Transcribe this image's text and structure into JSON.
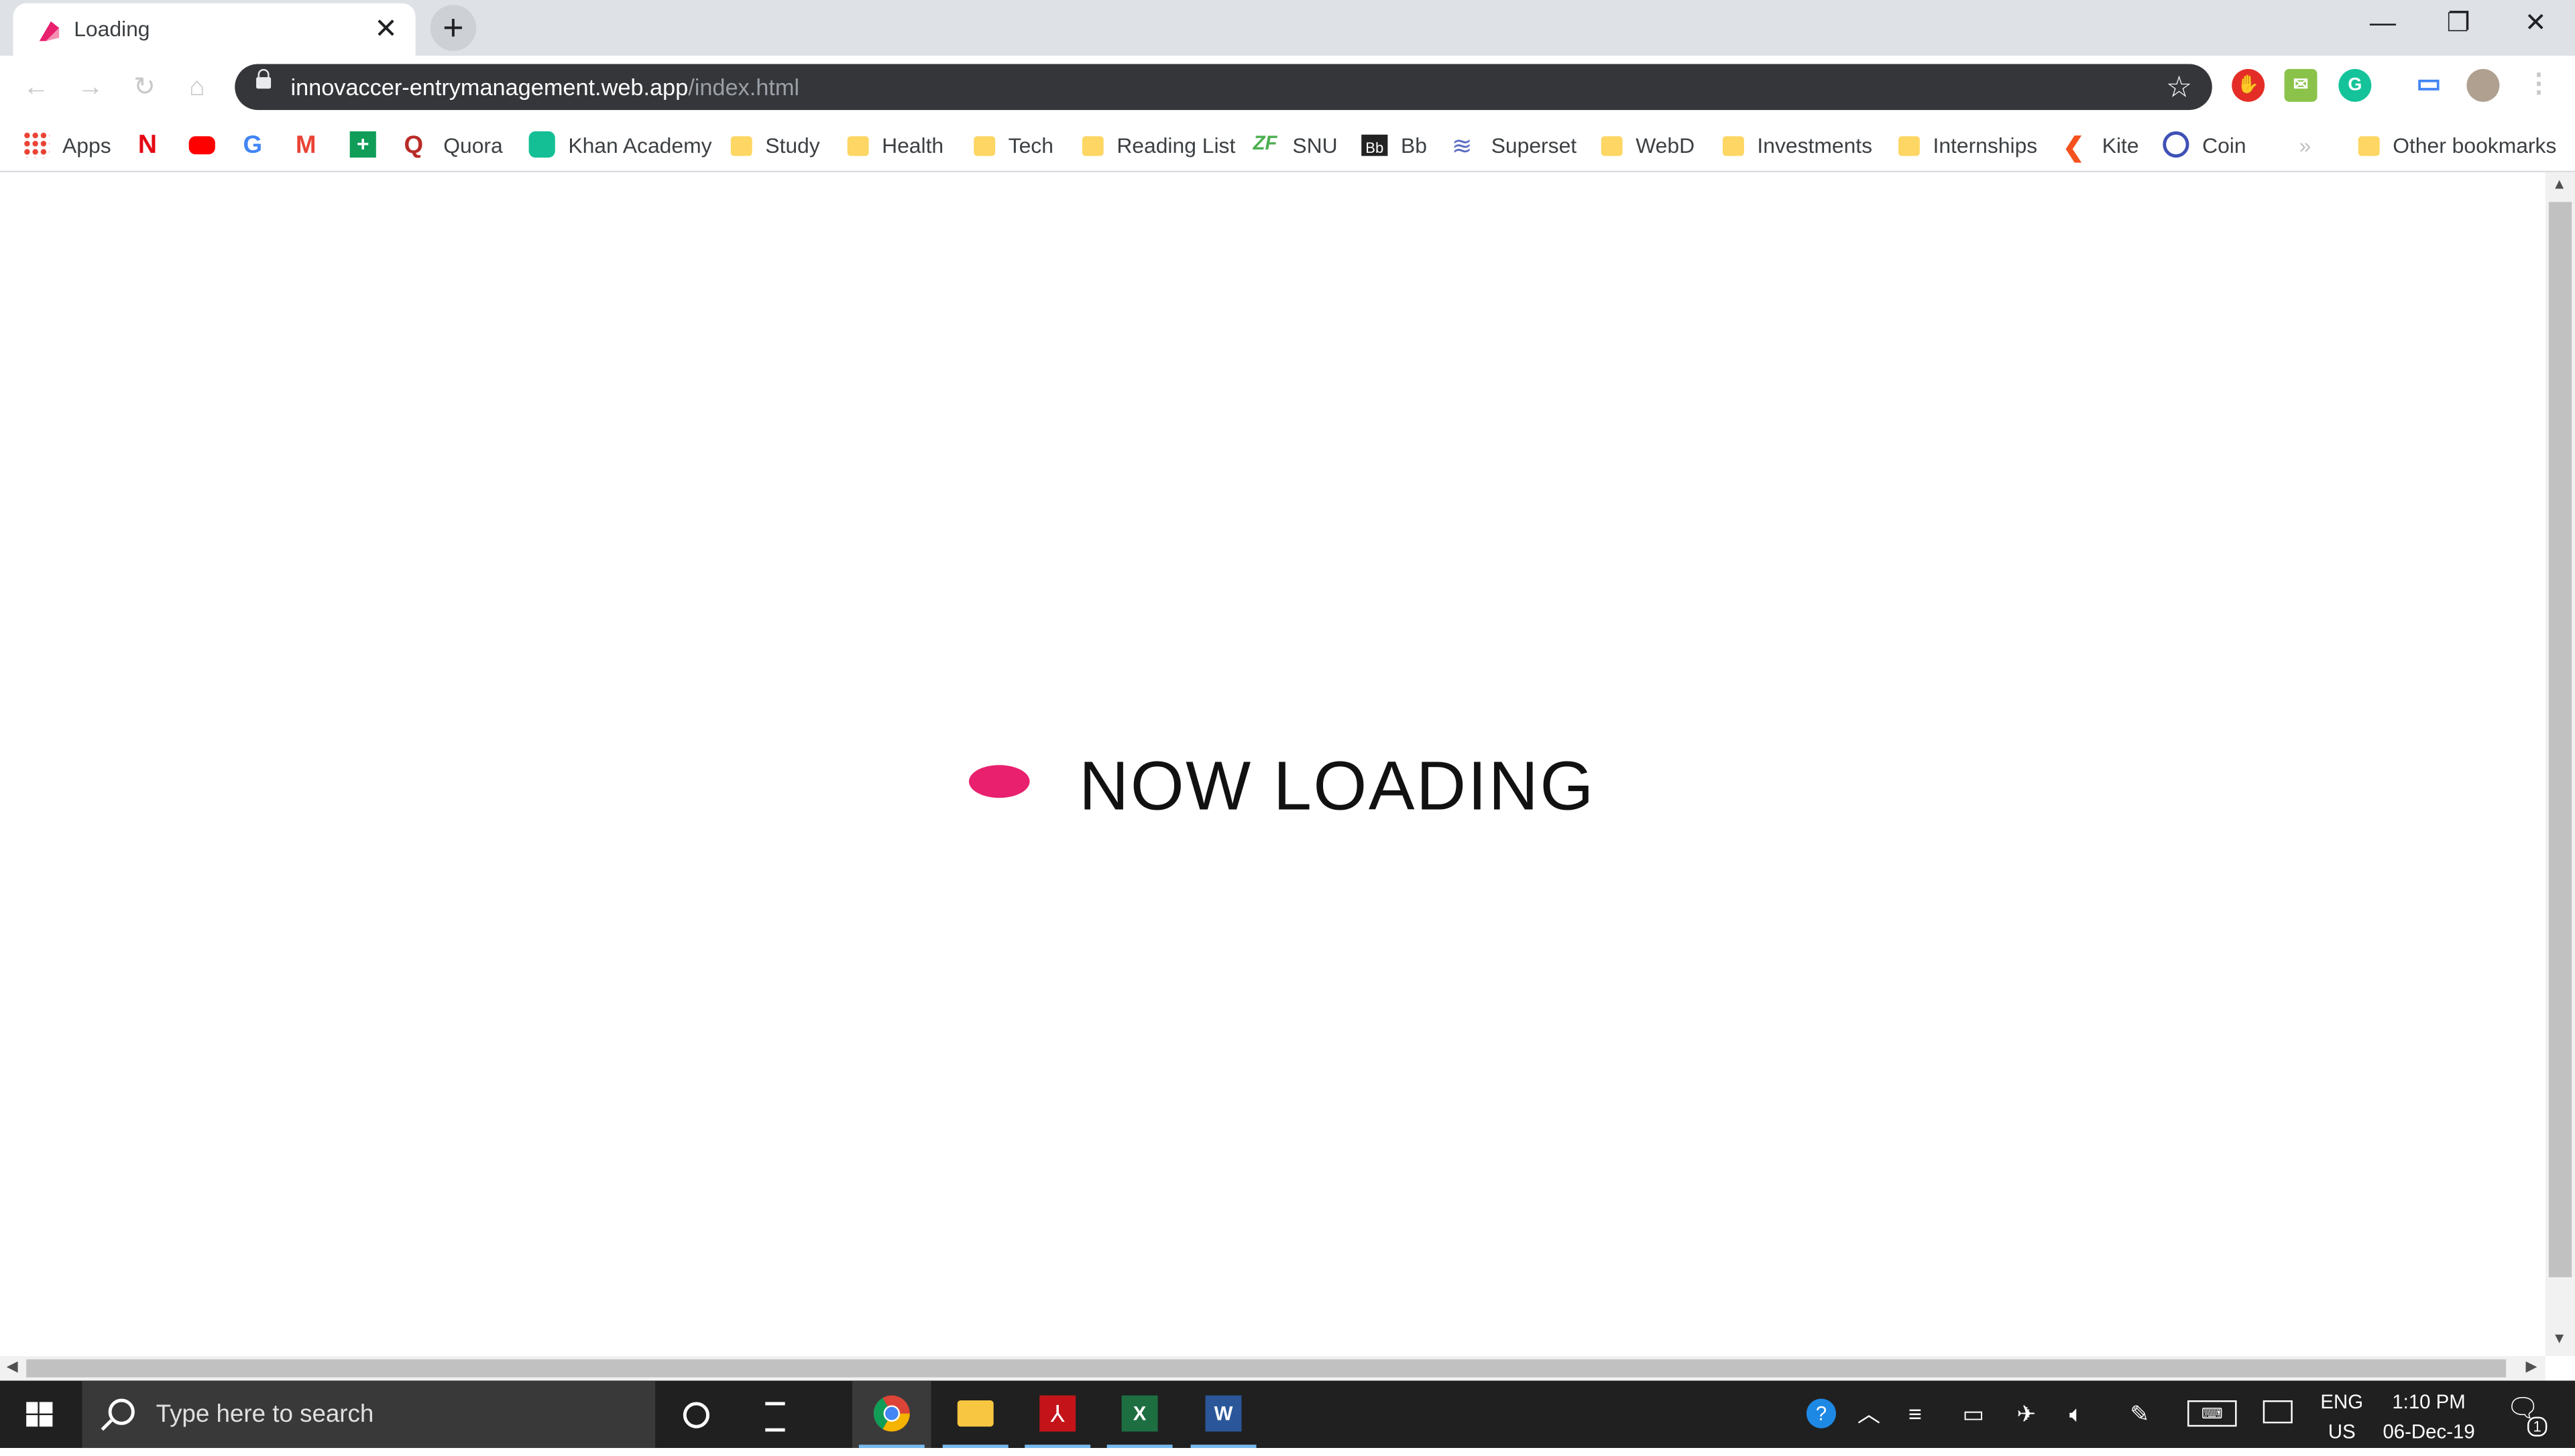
{
  "browser": {
    "tab": {
      "title": "Loading"
    },
    "address": {
      "host": "innovaccer-entrymanagement.web.app",
      "path": "/index.html"
    },
    "window_controls": {
      "minimize": "—",
      "restore": "❐",
      "close": "✕"
    }
  },
  "bookmarks": [
    {
      "label": "Apps",
      "icon": "apps-icon"
    },
    {
      "label": "",
      "icon": "netflix-icon"
    },
    {
      "label": "",
      "icon": "youtube-icon"
    },
    {
      "label": "",
      "icon": "google-icon"
    },
    {
      "label": "",
      "icon": "gmail-icon"
    },
    {
      "label": "",
      "icon": "plus-green-icon"
    },
    {
      "label": "Quora",
      "icon": "quora-icon"
    },
    {
      "label": "Khan Academy",
      "icon": "khan-academy-icon"
    },
    {
      "label": "Study",
      "icon": "folder-icon"
    },
    {
      "label": "Health",
      "icon": "folder-icon"
    },
    {
      "label": "Tech",
      "icon": "folder-icon"
    },
    {
      "label": "Reading List",
      "icon": "folder-icon"
    },
    {
      "label": "SNU",
      "icon": "snu-icon"
    },
    {
      "label": "Bb",
      "icon": "blackboard-icon"
    },
    {
      "label": "Superset",
      "icon": "superset-icon"
    },
    {
      "label": "WebD",
      "icon": "folder-icon"
    },
    {
      "label": "Investments",
      "icon": "folder-icon"
    },
    {
      "label": "Internships",
      "icon": "folder-icon"
    },
    {
      "label": "Kite",
      "icon": "kite-icon"
    },
    {
      "label": "Coin",
      "icon": "coin-icon"
    },
    {
      "label": "Other bookmarks",
      "icon": "folder-icon"
    }
  ],
  "page": {
    "loading_text": "NOW LOADING",
    "accent_color": "#e8206e"
  },
  "taskbar": {
    "search_placeholder": "Type here to search",
    "language": "ENG",
    "region": "US",
    "time": "1:10 PM",
    "date": "06-Dec-19",
    "notification_count": "1"
  }
}
